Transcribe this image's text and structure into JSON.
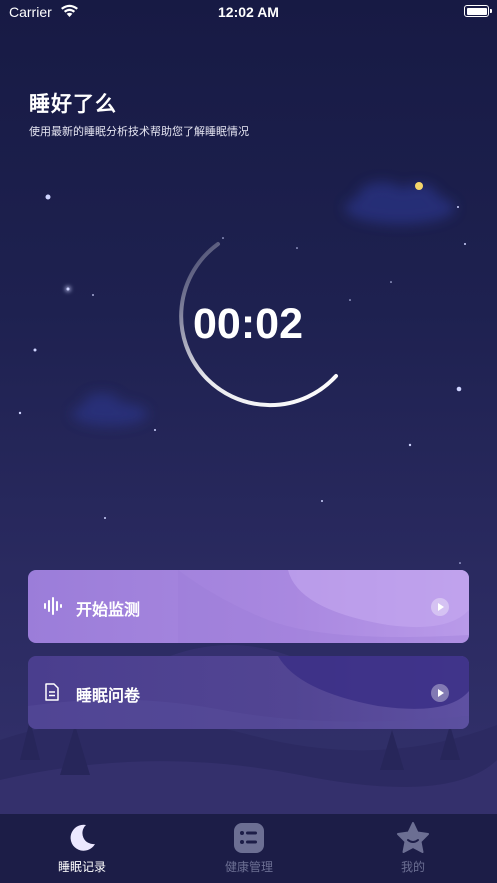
{
  "status_bar": {
    "carrier": "Carrier",
    "time": "12:02 AM"
  },
  "header": {
    "title": "睡好了么",
    "subtitle": "使用最新的睡眠分析技术帮助您了解睡眠情况"
  },
  "timer": {
    "value": "00:02"
  },
  "cards": {
    "start": {
      "label": "开始监测",
      "icon": "sound-wave-icon"
    },
    "survey": {
      "label": "睡眠问卷",
      "icon": "document-icon"
    }
  },
  "tabbar": {
    "items": [
      {
        "label": "睡眠记录",
        "icon": "moon-icon",
        "active": true
      },
      {
        "label": "健康管理",
        "icon": "list-icon",
        "active": false
      },
      {
        "label": "我的",
        "icon": "star-face-icon",
        "active": false
      }
    ]
  },
  "colors": {
    "accent": "#a988e0",
    "card_dark": "#4a3e8e",
    "tab_inactive": "#6c6f93"
  }
}
